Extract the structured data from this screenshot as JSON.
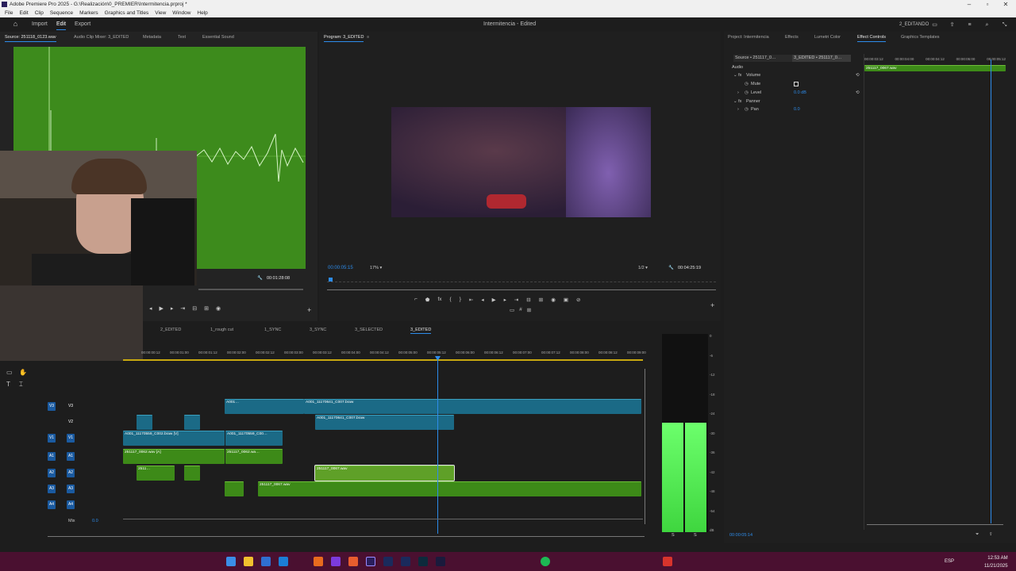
{
  "app": {
    "window_title": "Adobe Premiere Pro 2025 - G:\\Realización\\0_PREMIER\\Intermitencia.prproj *",
    "project_title": "Intermitencia",
    "project_status": "Edited",
    "workspace_label": "2_EDITANDO"
  },
  "menu": [
    "File",
    "Edit",
    "Clip",
    "Sequence",
    "Markers",
    "Graphics and Titles",
    "View",
    "Window",
    "Help"
  ],
  "header_tabs": [
    {
      "label": "Import",
      "active": false
    },
    {
      "label": "Edit",
      "active": true
    },
    {
      "label": "Export",
      "active": false
    }
  ],
  "source_panel": {
    "tabs": [
      "Source: 251118_0123.wav",
      "Audio Clip Mixer: 3_EDITED",
      "Metadata",
      "Text",
      "Essential Sound"
    ],
    "duration": "00:01:28:08"
  },
  "program_panel": {
    "tab": "Program: 3_EDITED",
    "current_time": "00:00:05:15",
    "zoom": "17%",
    "resolution": "1/2",
    "duration": "00:04:25:19"
  },
  "right_panel": {
    "tabs": [
      "Project: Intermitencia",
      "Effects",
      "Lumetri Color",
      "Effect Controls",
      "Graphics Templates"
    ],
    "active_tab": "Effect Controls",
    "source_selector": "Source • 251117_0…",
    "sequence_selector": "3_EDITED • 251117_0…",
    "section_audio": "Audio",
    "rows": [
      {
        "label": "Volume",
        "value": ""
      },
      {
        "label": "Mute",
        "value": ""
      },
      {
        "label": "Level",
        "value": "0.0 dB"
      },
      {
        "label": "Panner",
        "value": ""
      },
      {
        "label": "Pan",
        "value": "0.0"
      }
    ],
    "mini_ruler": [
      "00:00:03:12",
      "00:00:04:00",
      "00:00:04:12",
      "00:00:05:00",
      "00:00:05:12"
    ],
    "mini_clip": "251117_0067.wav",
    "footer_time": "00:00:05:14"
  },
  "timeline": {
    "sequence_tabs": [
      {
        "label": "2_EDITED",
        "active": false
      },
      {
        "label": "1_rough cut",
        "active": false
      },
      {
        "label": "1_SYNC",
        "active": false
      },
      {
        "label": "3_SYNC",
        "active": false
      },
      {
        "label": "3_SELECTED",
        "active": false
      },
      {
        "label": "3_EDITED",
        "active": true
      }
    ],
    "ruler": [
      "00:00:00:12",
      "00:00:01:00",
      "00:00:01:12",
      "00:00:02:00",
      "00:00:02:12",
      "00:00:03:00",
      "00:00:03:12",
      "00:00:04:00",
      "00:00:04:12",
      "00:00:05:00",
      "00:00:05:12",
      "00:00:06:00",
      "00:00:06:12",
      "00:00:07:00",
      "00:00:07:12",
      "00:00:08:00",
      "00:00:08:12",
      "00:00:09:00"
    ],
    "tracks": [
      "V3",
      "V2",
      "V1",
      "A1",
      "A2",
      "A3",
      "A4"
    ],
    "mix_label": "Mix",
    "mix_value": "0.0",
    "clips": {
      "v3_a": "A001…",
      "v3_b": "A001_11170641_C007.braw",
      "v2_a": "A001_11170641_C007.braw",
      "v1_a": "A001_11170559_C002.braw [V]",
      "v1_b": "A001_11170559_C00…",
      "a1_a": "251117_0062.wav [A]",
      "a1_b": "251117_0062.wa…",
      "a2_a": "2511…",
      "a2_b": "251117_0067.wav",
      "a3_a": "251117_0067.wav"
    }
  },
  "meter": {
    "scale": [
      "0",
      "-6",
      "-12",
      "-18",
      "-24",
      "-30",
      "-36",
      "-42",
      "-48",
      "-54",
      "dB"
    ],
    "level_left": 0.55,
    "level_right": 0.55,
    "footer": [
      "S",
      "S"
    ]
  },
  "taskbar": {
    "lang": "ESP",
    "time": "12:53 AM",
    "date": "11/21/2025"
  },
  "colors": {
    "accent": "#2d8ceb",
    "video_clip": "#1b6a86",
    "audio_clip": "#3d8a18",
    "source_bg": "#3a8a1a",
    "taskbar": "#4a1030"
  }
}
